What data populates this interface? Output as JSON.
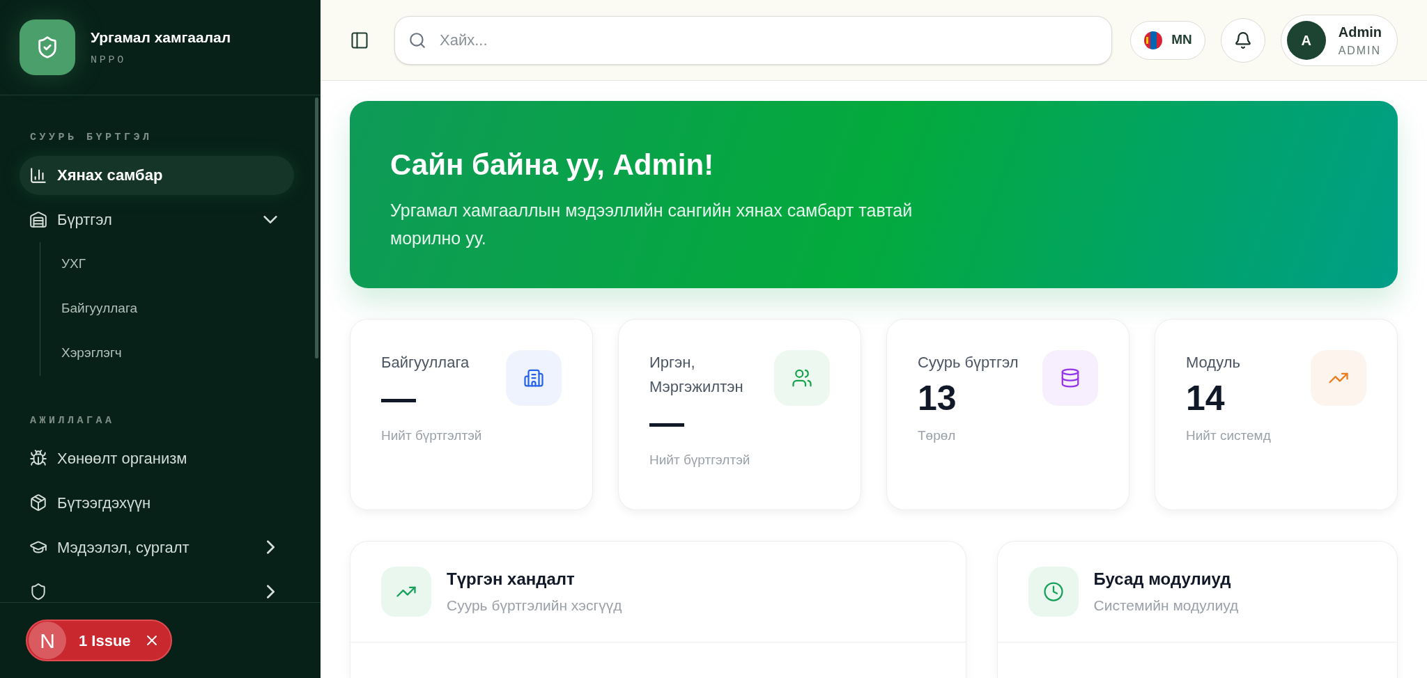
{
  "sidebar": {
    "brand": {
      "title": "Ургамал хамгаалал",
      "subtitle": "NPPO"
    },
    "sections": [
      {
        "heading": "СУУРЬ БҮРТГЭЛ",
        "items": [
          {
            "label": "Хянах самбар",
            "kind": "chart",
            "selected": true
          },
          {
            "label": "Бүртгэл",
            "kind": "warehouse",
            "selected": false,
            "expanded": true,
            "children": [
              {
                "label": "УХГ",
                "selected": false
              },
              {
                "label": "Байгууллага",
                "selected": false
              },
              {
                "label": "Хэрэглэгч",
                "selected": false
              }
            ]
          }
        ]
      },
      {
        "heading": "АЖИЛЛАГАА",
        "items": [
          {
            "label": "Хөнөөлт организм",
            "kind": "bug",
            "selected": false
          },
          {
            "label": "Бүтээгдэхүүн",
            "kind": "package",
            "selected": false
          },
          {
            "label": "Мэдээлэл, сургалт",
            "kind": "cap",
            "selected": false,
            "expanded": false
          },
          {
            "kind": "shield",
            "selected": false,
            "expanded": false
          }
        ]
      }
    ]
  },
  "issue_badge": {
    "logo": "N",
    "label": "1 Issue"
  },
  "header": {
    "search": {
      "placeholder": "Хайх..."
    },
    "language": "MN",
    "user": {
      "initial": "A",
      "name": "Admin",
      "role": "ADMIN"
    }
  },
  "banner": {
    "title": "Сайн байна уу, Admin!",
    "text": "Ургамал хамгааллын мэдээллийн сангийн хянах самбарт тавтай морилно уу."
  },
  "stats": [
    {
      "label": "Байгууллага",
      "value": "—",
      "caption": "Нийт бүртгэлтэй",
      "kind": "building",
      "color": "#2563eb"
    },
    {
      "label": "Иргэн, Мэргэжилтэн",
      "value": "—",
      "caption": "Нийт бүртгэлтэй",
      "kind": "users",
      "color": "#16a34a"
    },
    {
      "label": "Суурь бүртгэл",
      "value": "13",
      "caption": "Төрөл",
      "kind": "database",
      "color": "#9333ea"
    },
    {
      "label": "Модуль",
      "value": "14",
      "caption": "Нийт системд",
      "kind": "trending",
      "color": "#ea7a1a"
    }
  ],
  "panels": [
    {
      "title": "Түргэн хандалт",
      "subtitle": "Суурь бүртгэлийн хэсгүүд",
      "kind": "trending"
    },
    {
      "title": "Бусад модулиуд",
      "subtitle": "Системийн модулиуд",
      "kind": "clock"
    }
  ]
}
